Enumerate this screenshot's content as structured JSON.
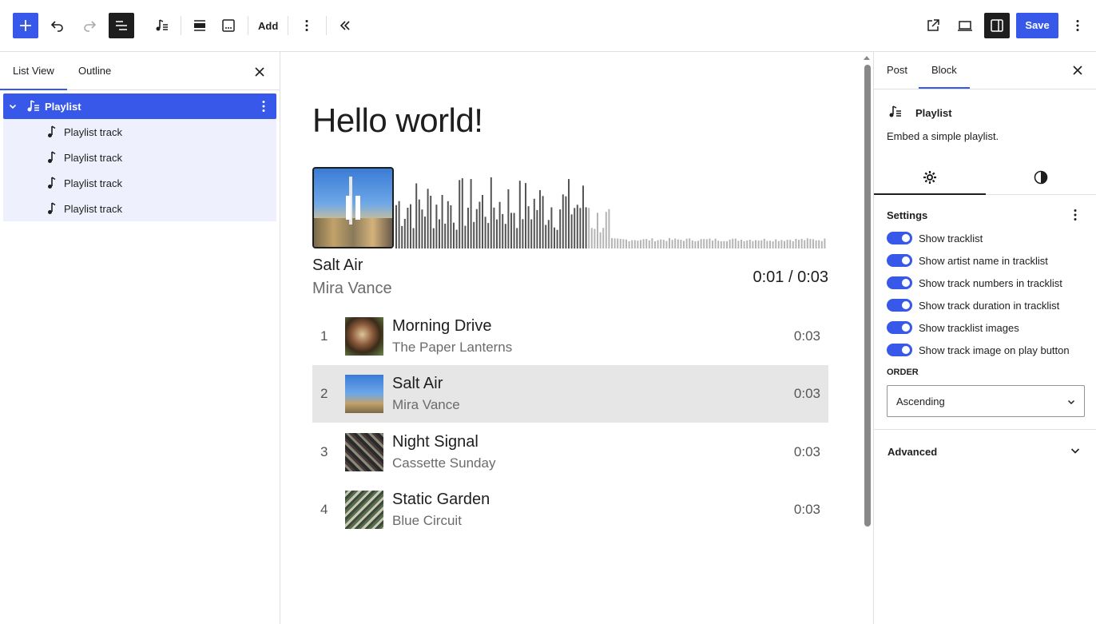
{
  "toolbar": {
    "add_label": "Add",
    "save_label": "Save"
  },
  "left_panel": {
    "tabs": [
      {
        "label": "List View"
      },
      {
        "label": "Outline"
      }
    ],
    "items": [
      {
        "label": "Playlist",
        "selected": true
      },
      {
        "label": "Playlist track"
      },
      {
        "label": "Playlist track"
      },
      {
        "label": "Playlist track"
      },
      {
        "label": "Playlist track"
      }
    ]
  },
  "canvas": {
    "heading": "Hello world!",
    "player": {
      "title": "Salt Air",
      "artist": "Mira Vance",
      "time": "0:01 / 0:03",
      "progress": 0.33
    },
    "tracks": [
      {
        "num": "1",
        "title": "Morning Drive",
        "artist": "The Paper Lanterns",
        "duration": "0:03",
        "active": false
      },
      {
        "num": "2",
        "title": "Salt Air",
        "artist": "Mira Vance",
        "duration": "0:03",
        "active": true
      },
      {
        "num": "3",
        "title": "Night Signal",
        "artist": "Cassette Sunday",
        "duration": "0:03",
        "active": false
      },
      {
        "num": "4",
        "title": "Static Garden",
        "artist": "Blue Circuit",
        "duration": "0:03",
        "active": false
      }
    ]
  },
  "right_panel": {
    "tabs": [
      {
        "label": "Post"
      },
      {
        "label": "Block"
      }
    ],
    "block_name": "Playlist",
    "block_desc": "Embed a simple playlist.",
    "settings_title": "Settings",
    "toggles": [
      {
        "label": "Show tracklist",
        "on": true
      },
      {
        "label": "Show artist name in tracklist",
        "on": true
      },
      {
        "label": "Show track numbers in tracklist",
        "on": true
      },
      {
        "label": "Show track duration in tracklist",
        "on": true
      },
      {
        "label": "Show tracklist images",
        "on": true
      },
      {
        "label": "Show track image on play button",
        "on": true
      }
    ],
    "order_label": "ORDER",
    "order_value": "Ascending",
    "advanced_label": "Advanced"
  },
  "colors": {
    "accent": "#3858e9",
    "selected_row": "#e6e6e6"
  }
}
